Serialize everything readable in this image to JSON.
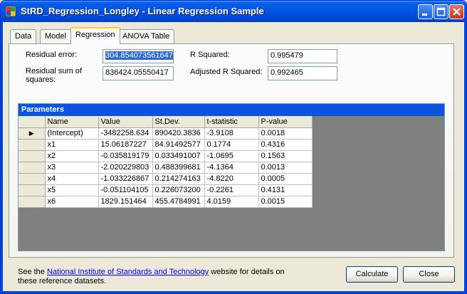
{
  "window": {
    "title": "StRD_Regression_Longley - Linear Regression Sample"
  },
  "tabs": [
    {
      "label": "Data"
    },
    {
      "label": "Model"
    },
    {
      "label": "Regression"
    },
    {
      "label": "ANOVA Table"
    }
  ],
  "regression": {
    "residual_error_label": "Residual error:",
    "residual_error_value": "304.854073561647",
    "rss_label": "Residual sum of squares:",
    "rss_value": "836424.05550417",
    "r_squared_label": "R Squared:",
    "r_squared_value": "0.995479",
    "adj_r_squared_label": "Adjusted R Squared:",
    "adj_r_squared_value": "0.992465"
  },
  "parameters": {
    "caption": "Parameters",
    "columns": [
      "Name",
      "Value",
      "St.Dev.",
      "t-statistic",
      "P-value"
    ],
    "current_row_marker": "▶",
    "rows": [
      [
        "(Intercept)",
        "-3482258.634",
        "890420.3836",
        "-3.9108",
        "0.0018"
      ],
      [
        "x1",
        "15.06187227",
        "84.91492577",
        "0.1774",
        "0.4316"
      ],
      [
        "x2",
        "-0.035819179",
        "0.033491007",
        "-1.0695",
        "0.1563"
      ],
      [
        "x3",
        "-2.020229803",
        "0.488399681",
        "-4.1364",
        "0.0013"
      ],
      [
        "x4",
        "-1.033226867",
        "0.214274163",
        "-4.8220",
        "0.0005"
      ],
      [
        "x5",
        "-0.051104105",
        "0.226073200",
        "-0.2261",
        "0.4131"
      ],
      [
        "x6",
        "1829.151464",
        "455.4784991",
        "4.0159",
        "0.0015"
      ]
    ]
  },
  "footer": {
    "text_before": "See the ",
    "link_text": "National Institute of Standards and Technology",
    "text_after": " website for details on these reference datasets.",
    "calculate_label": "Calculate",
    "close_label": "Close"
  },
  "colors": {
    "titlebar": "#0054e3",
    "grid_caption": "#0a54e0",
    "selection": "#316ac5"
  }
}
